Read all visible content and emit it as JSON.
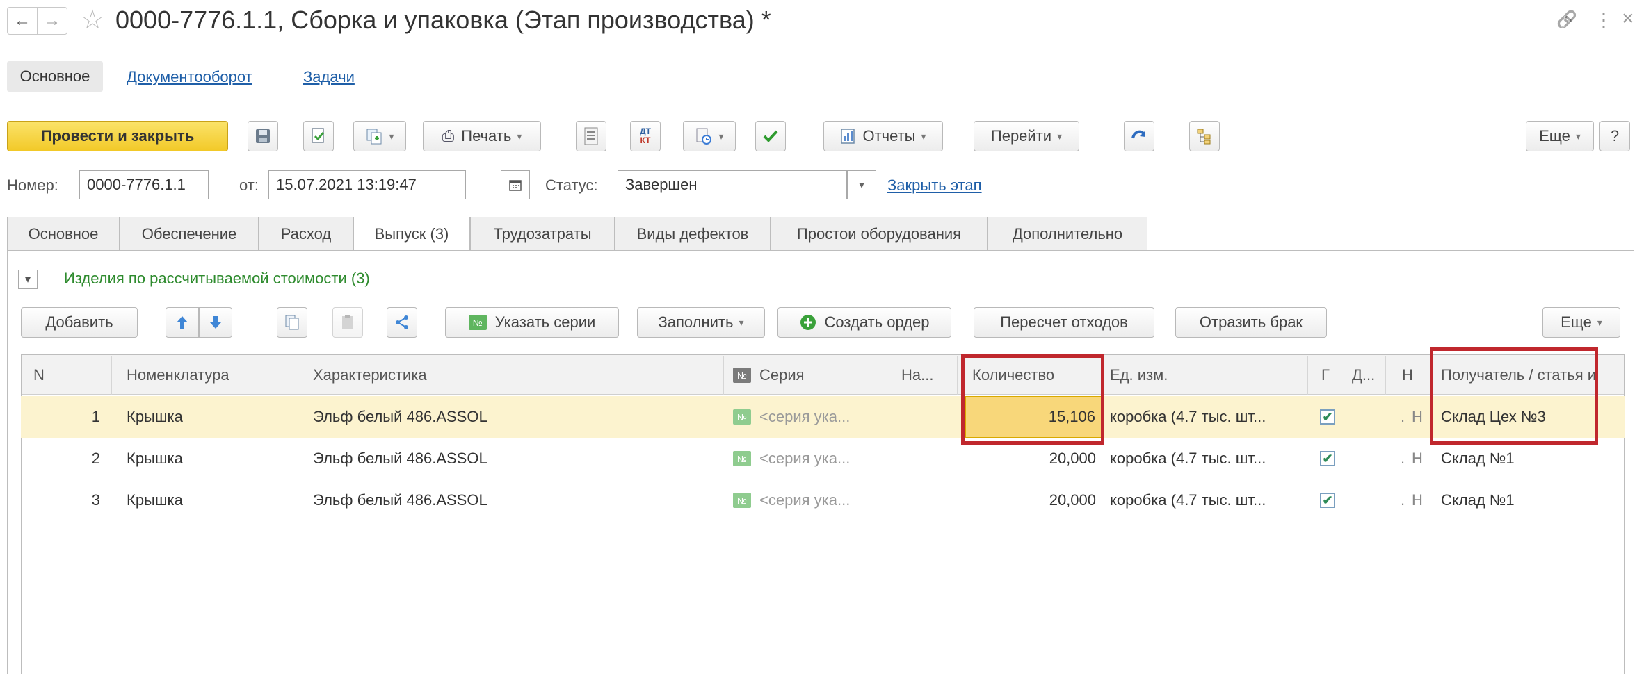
{
  "window": {
    "title": "0000-7776.1.1, Сборка и упаковка (Этап производства) *",
    "nav_back": "←",
    "nav_forward": "→",
    "star": "☆",
    "link_icon": "🔗",
    "more_icon": "⋮",
    "close_icon": "×"
  },
  "top_tabs": {
    "main": "Основное",
    "docflow": "Документооборот",
    "tasks": "Задачи"
  },
  "toolbar": {
    "post_close": "Провести и закрыть",
    "print": "Печать",
    "reports": "Отчеты",
    "goto": "Перейти",
    "more": "Еще",
    "help": "?",
    "dtkt_top": "ДТ",
    "dtkt_bottom": "КТ"
  },
  "header": {
    "number_label": "Номер:",
    "number_value": "0000-7776.1.1",
    "date_label": "от:",
    "date_value": "15.07.2021 13:19:47",
    "status_label": "Статус:",
    "status_value": "Завершен",
    "close_stage_link": "Закрыть этап"
  },
  "tabs": [
    {
      "label": "Основное"
    },
    {
      "label": "Обеспечение"
    },
    {
      "label": "Расход"
    },
    {
      "label": "Выпуск (3)"
    },
    {
      "label": "Трудозатраты"
    },
    {
      "label": "Виды дефектов"
    },
    {
      "label": "Простои оборудования"
    },
    {
      "label": "Дополнительно"
    }
  ],
  "active_tab_index": 3,
  "group": {
    "toggle": "⌄",
    "title": "Изделия по рассчитываемой стоимости (3)"
  },
  "table_toolbar": {
    "add": "Добавить",
    "specify_series": "Указать серии",
    "fill": "Заполнить",
    "create_order": "Создать ордер",
    "recalc_waste": "Пересчет отходов",
    "reflect_defect": "Отразить брак",
    "more": "Еще"
  },
  "columns": {
    "n": "N",
    "nomenclature": "Номенклатура",
    "characteristic": "Характеристика",
    "series": "Серия",
    "na": "На...",
    "quantity": "Количество",
    "unit": "Ед. изм.",
    "g": "Г",
    "d": "Д...",
    "h": "Н",
    "recipient": "Получатель / статья и"
  },
  "rows": [
    {
      "n": "1",
      "nomenclature": "Крышка",
      "characteristic": "Эльф белый 486.ASSOL",
      "series": "<серия ука...",
      "quantity": "15,106",
      "unit": "коробка (4.7 тыс. шт...",
      "checked": "✔",
      "dot": ".",
      "h": "Н",
      "recipient": "Склад Цех №3"
    },
    {
      "n": "2",
      "nomenclature": "Крышка",
      "characteristic": "Эльф белый 486.ASSOL",
      "series": "<серия ука...",
      "quantity": "20,000",
      "unit": "коробка (4.7 тыс. шт...",
      "checked": "✔",
      "dot": ".",
      "h": "Н",
      "recipient": "Склад №1"
    },
    {
      "n": "3",
      "nomenclature": "Крышка",
      "characteristic": "Эльф белый 486.ASSOL",
      "series": "<серия ука...",
      "quantity": "20,000",
      "unit": "коробка (4.7 тыс. шт...",
      "checked": "✔",
      "dot": ".",
      "h": "Н",
      "recipient": "Склад №1"
    }
  ],
  "series_badge": "№",
  "colors": {
    "primary_button": "#f7d43b",
    "selected_row": "#fcf3cf",
    "active_cell": "#f8d77a",
    "group_title": "#2e8b2e",
    "highlight_box": "#c0272d",
    "link": "#1f5fa8"
  }
}
